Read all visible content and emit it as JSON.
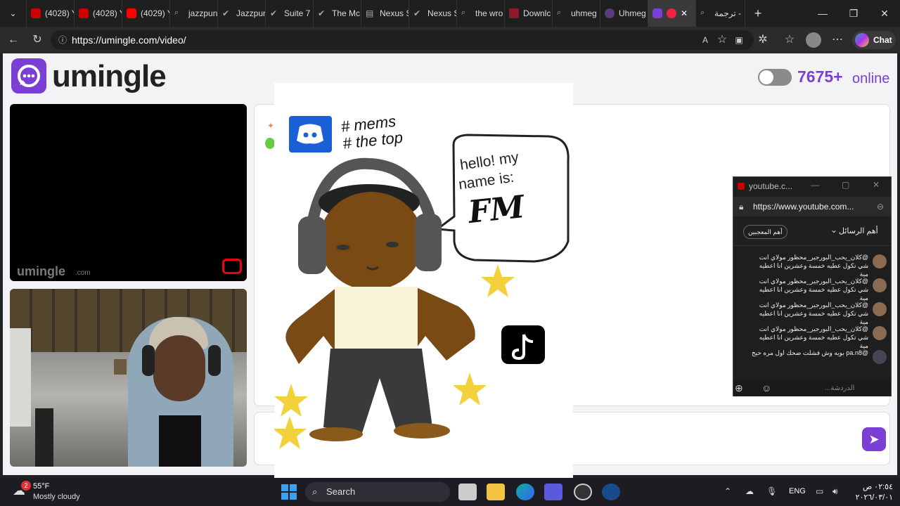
{
  "browser": {
    "tabs": [
      {
        "label": "(4028) Y",
        "icon": "youtube-icon"
      },
      {
        "label": "(4028) Y",
        "icon": "youtube-icon"
      },
      {
        "label": "(4029) Y",
        "icon": "youtube-icon"
      },
      {
        "label": "jazzpun",
        "icon": "search-icon"
      },
      {
        "label": "Jazzpur",
        "icon": "steam-icon"
      },
      {
        "label": "Suite 7",
        "icon": "steam-icon"
      },
      {
        "label": "The Mc",
        "icon": "steam-icon"
      },
      {
        "label": "Nexus S",
        "icon": "doc-icon"
      },
      {
        "label": "Nexus S",
        "icon": "steam-icon"
      },
      {
        "label": "the wro",
        "icon": "search-icon"
      },
      {
        "label": "Downlc",
        "icon": "download-icon"
      },
      {
        "label": "uhmeg",
        "icon": "search-icon"
      },
      {
        "label": "Uhmeg",
        "icon": "globe-icon"
      },
      {
        "label": "",
        "icon": "chat-icon"
      },
      {
        "label": "ترجمة -",
        "icon": "search-icon"
      }
    ],
    "url": "https://umingle.com/video/",
    "chat_button": "Chat"
  },
  "site": {
    "logo_text": "umingle",
    "online_count": "7675+",
    "online_label": "online",
    "watermark_main": "umingle",
    "watermark_suffix": ".com"
  },
  "drawing": {
    "hashtag": "# mems\n# the top",
    "bubble_line1": "hello! my",
    "bubble_line2": "name is:",
    "bubble_name": "FM"
  },
  "popup": {
    "title": "youtube.c...",
    "url": "https://www.youtube.com...",
    "top_chat": "أهم الرسائل",
    "top_fans": "أهم المعجبين",
    "messages": [
      "@كلان_يحب_البورجير_محظور  مولاي انت شي تكول عطيه خمسة وعشرين انا اعطيه مية",
      "@كلان_يحب_البورجير_محظور  مولاي انت شي تكول عطيه خمسة وعشرين انا اعطيه مية",
      "@كلان_يحب_البورجير_محظور  مولاي انت شي تكول عطيه خمسة وعشرين انا اعطيه مية",
      "@كلان_يحب_البورجير_محظور  مولاي انت شي تكول عطيه خمسة وعشرين انا اعطيه مية",
      "@pa.n8  بويه وش فشلت ضحك اول مره حيح"
    ],
    "input_placeholder": "الدردشة..."
  },
  "taskbar": {
    "weather_temp": "55°F",
    "weather_desc": "Mostly cloudy",
    "weather_badge": "2",
    "search": "Search",
    "lang": "ENG",
    "time": "٠٢:٥٤ ص",
    "date": "٢٠٢٦/٠٣/٠١"
  },
  "colors": {
    "brand": "#7b3fd6",
    "discord": "#1a5fd6",
    "star": "#f2d13a"
  }
}
